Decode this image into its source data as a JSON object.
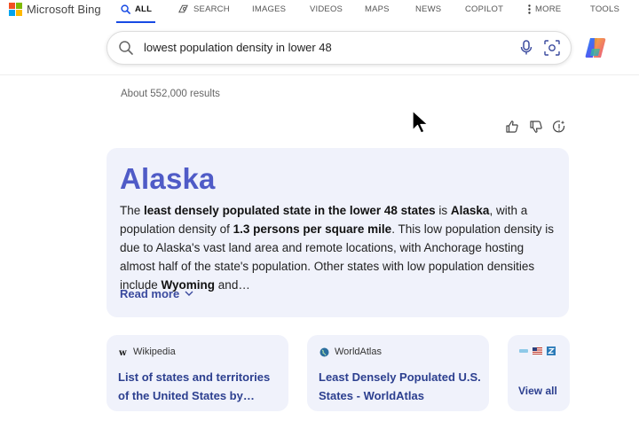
{
  "brand": {
    "name": "Microsoft Bing"
  },
  "nav": {
    "items": [
      {
        "label": "ALL",
        "icon": "search-icon",
        "active": true
      },
      {
        "label": "SEARCH",
        "icon": "copilot-search-icon"
      },
      {
        "label": "IMAGES"
      },
      {
        "label": "VIDEOS"
      },
      {
        "label": "MAPS"
      },
      {
        "label": "NEWS"
      },
      {
        "label": "COPILOT"
      },
      {
        "label": "MORE",
        "icon": "more-vertical-icon"
      },
      {
        "label": "TOOLS"
      }
    ]
  },
  "search": {
    "query": "lowest population density in lower 48"
  },
  "results": {
    "count": "About 552,000 results"
  },
  "answer": {
    "title": "Alaska",
    "segments": [
      {
        "t": "The ",
        "b": false
      },
      {
        "t": "least densely populated state in the lower 48 states",
        "b": true
      },
      {
        "t": " is ",
        "b": false
      },
      {
        "t": "Alaska",
        "b": true
      },
      {
        "t": ", with a population density of ",
        "b": false
      },
      {
        "t": "1.3 persons per square mile",
        "b": true
      },
      {
        "t": ". This low population density is due to Alaska's vast land area and remote locations, with Anchorage hosting almost half of the state's population. Other states with low population densities include ",
        "b": false
      },
      {
        "t": "Wyoming",
        "b": true
      },
      {
        "t": " and…",
        "b": false
      }
    ],
    "read_more": "Read more"
  },
  "sources": [
    {
      "site": "Wikipedia",
      "title": "List of states and territories of the United States by…"
    },
    {
      "site": "WorldAtlas",
      "title": "Least Densely Populated U.S. States - WorldAtlas"
    }
  ],
  "view_all": "View all",
  "colors": {
    "accent": "#174ae4",
    "answer_title": "#4f5bc7",
    "card_bg": "#f0f2fb",
    "link": "#2c3f8f"
  }
}
